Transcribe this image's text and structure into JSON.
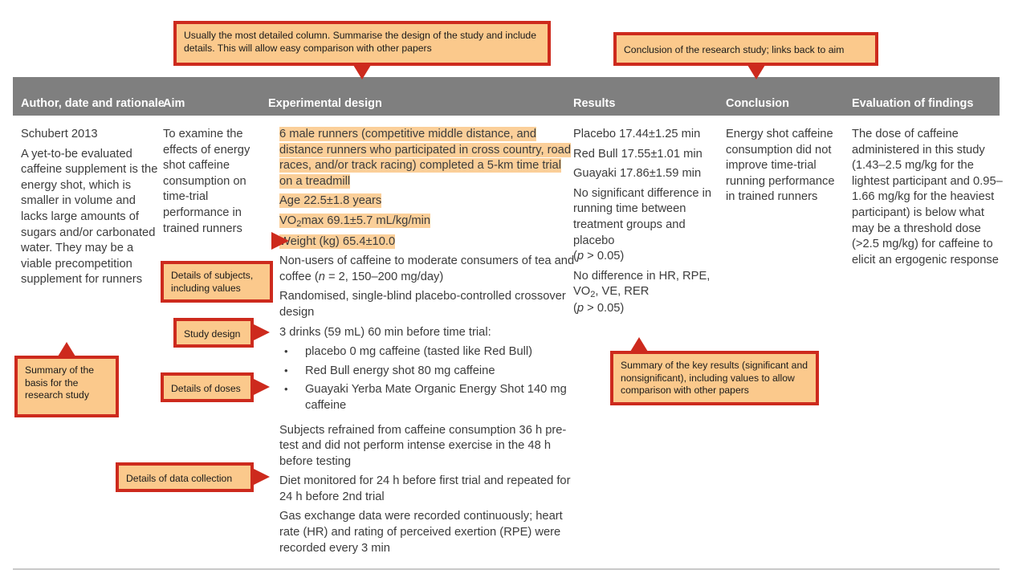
{
  "table": {
    "headers": [
      {
        "label": "Author, date and rationale"
      },
      {
        "label": "Aim"
      },
      {
        "label": "Experimental design"
      },
      {
        "label": "Results"
      },
      {
        "label": "Conclusion"
      },
      {
        "label": "Evaluation of findings"
      }
    ],
    "columns": {
      "author": {
        "p1": "Schubert 2013",
        "p2": "A yet-to-be evaluated caffeine supplement is the energy shot, which is smaller in volume and lacks large amounts of sugars and/or carbonated water. They may be a viable precompetition supplement for runners"
      },
      "aim": {
        "p1": "To examine the effects of energy shot caffeine consumption on time-trial performance in trained runners"
      },
      "design": {
        "hl1": "6 male runners (competitive middle distance, and distance runners who participated in cross country, road races, and/or track racing) completed a 5-km time trial on a treadmill",
        "hl2": "Age 22.5±1.8 years",
        "hl3_pre": "VO",
        "hl3_sub": "2",
        "hl3_post": "max 69.1±5.7 mL/kg/min",
        "hl4": "Weight (kg) 65.4±10.0",
        "p5_a": "Non-users of caffeine to moderate consumers of tea and coffee (",
        "p5_n": "n",
        "p5_b": " = 2, 150–200 mg/day)",
        "p6": "Randomised, single-blind placebo-controlled crossover design",
        "p7": "3 drinks (59 mL) 60 min before time trial:",
        "bullets": [
          "placebo 0 mg caffeine (tasted like Red Bull)",
          "Red Bull energy shot 80 mg caffeine",
          "Guayaki Yerba Mate Organic Energy Shot 140 mg caffeine"
        ],
        "p8": "Subjects refrained from caffeine consumption 36 h pre-test and did not perform intense exercise in the 48 h before testing",
        "p9": "Diet monitored for 24 h before first trial and repeated for 24 h before 2nd trial",
        "p10": "Gas exchange data were recorded continuously; heart rate (HR) and rating of perceived exertion (RPE) were recorded every 3 min"
      },
      "results": {
        "p1": "Placebo 17.44±1.25 min",
        "p2": "Red Bull 17.55±1.01 min",
        "p3": "Guayaki 17.86±1.59 min",
        "p4": "No significant difference in running time between treatment groups and placebo",
        "p4_stat_open": "(",
        "p4_stat_p": "p",
        "p4_stat_close": " > 0.05)",
        "p5_a": "No difference in HR, RPE, VO",
        "p5_sub": "2",
        "p5_b": ", VE, RER",
        "p6_open": "(",
        "p6_p": "p",
        "p6_close": " > 0.05)"
      },
      "conclusion": {
        "p1": "Energy shot caffeine consumption did not improve time-trial running performance in trained runners"
      },
      "evaluation": {
        "p1": "The dose of caffeine administered in this study (1.43–2.5 mg/kg for the lightest participant and 0.95–1.66 mg/kg for the heaviest participant) is below what may be a threshold dose (>2.5 mg/kg) for caffeine to elicit an ergogenic response"
      }
    }
  },
  "callouts": {
    "design_top": "Usually the most detailed column. Summarise the design of the study and include details. This will allow easy comparison with other papers",
    "conclusion_top": "Conclusion of the research study; links back to aim",
    "subjects": "Details of subjects, including values",
    "study_design": "Study design",
    "doses": "Details of doses",
    "data_collection": "Details of data collection",
    "basis": "Summary of the basis for the research study",
    "key_results": "Summary of the key results (significant and nonsignificant), including values to allow comparison with other papers"
  },
  "colors": {
    "header_gray": "#7f7f7f",
    "callout_fill": "#fbc98c",
    "callout_border": "#cd2a1d",
    "highlight": "#fbcf99",
    "body_text": "#3c3c3c",
    "rule": "#c9c9c9"
  }
}
